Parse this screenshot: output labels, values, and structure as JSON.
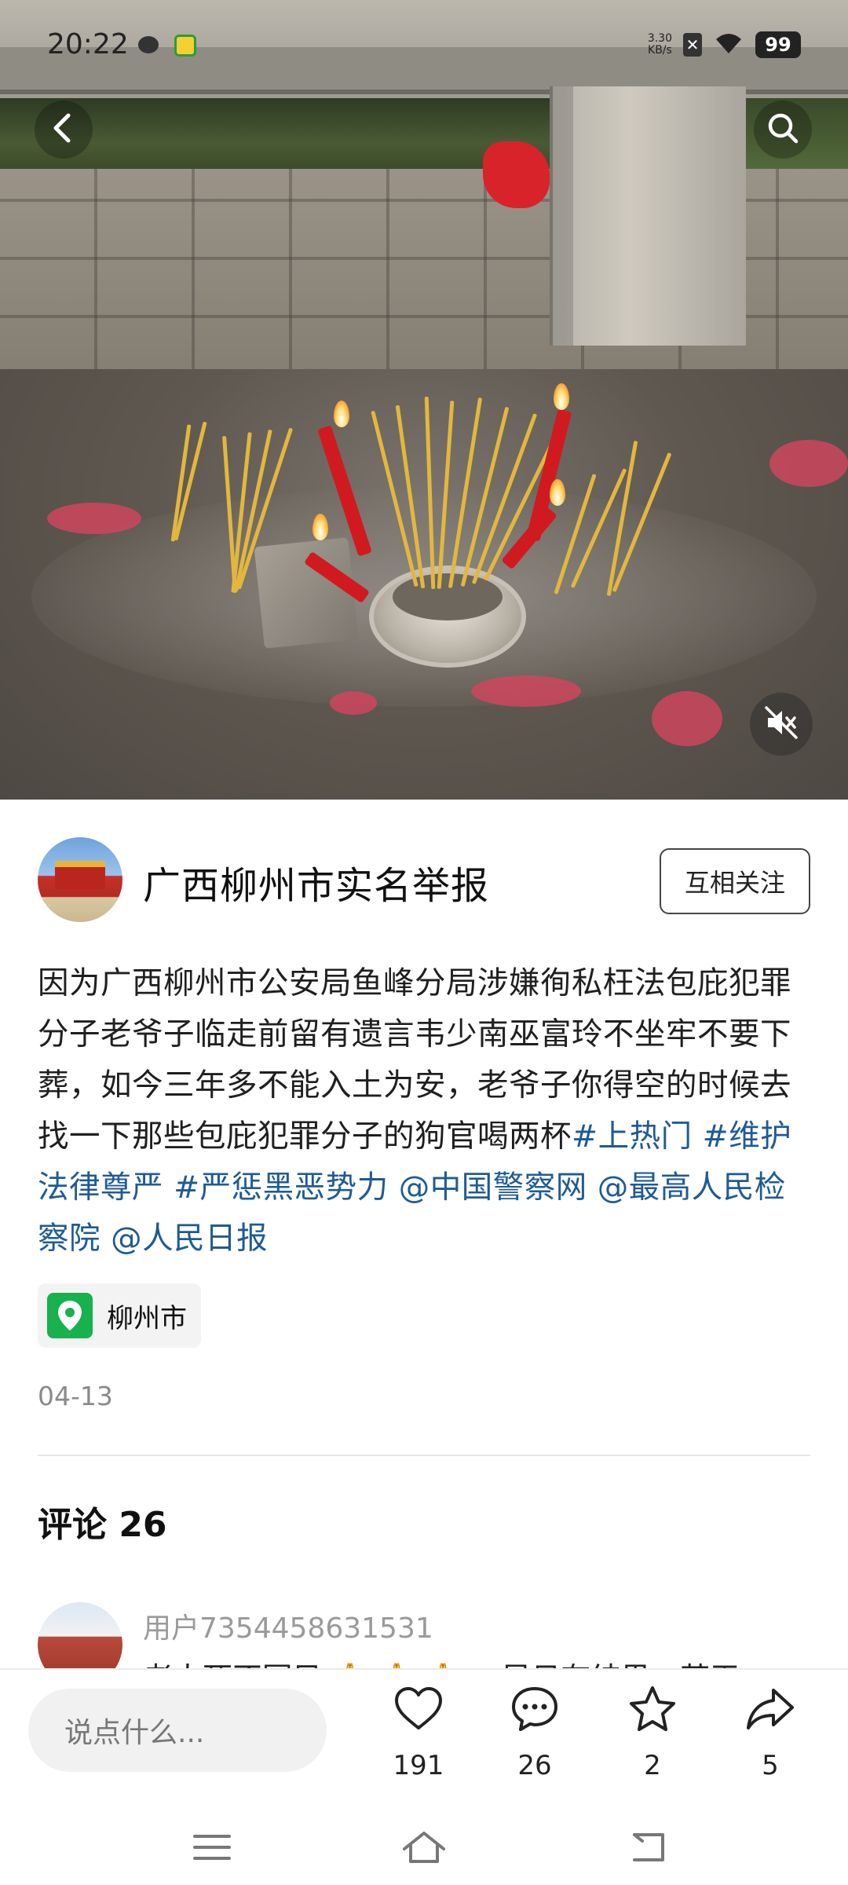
{
  "status_bar": {
    "time": "20:22",
    "net_speed_value": "3.30",
    "net_speed_unit": "KB/s",
    "battery": "99"
  },
  "media": {
    "back_icon": "chevron-left-icon",
    "search_icon": "search-icon",
    "mute_icon": "speaker-muted-icon"
  },
  "author": {
    "name": "广西柳州市实名举报",
    "follow_label": "互相关注"
  },
  "post": {
    "text": "因为广西柳州市公安局鱼峰分局涉嫌徇私枉法包庇犯罪分子老爷子临走前留有遗言韦少南巫富玲不坐牢不要下葬，如今三年多不能入土为安，老爷子你得空的时候去找一下那些包庇犯罪分子的狗官喝两杯",
    "tags": [
      "#上热门",
      "#维护法律尊严",
      "#严惩黑恶势力",
      "@中国警察网",
      "@最高人民检察院",
      "@人民日报"
    ],
    "location": "柳州市",
    "date": "04-13"
  },
  "comments": {
    "title": "评论 26",
    "items": [
      {
        "user": "用户7354458631531",
        "text": "老人死不冥目 🙏 🙏 🙏 ，早日有结果，苍天"
      }
    ]
  },
  "bottom_bar": {
    "input_placeholder": "说点什么...",
    "like_count": "191",
    "comment_count": "26",
    "favorite_count": "2",
    "share_count": "5"
  },
  "colors": {
    "tag": "#1f5b93",
    "location_pin": "#17b14d"
  }
}
